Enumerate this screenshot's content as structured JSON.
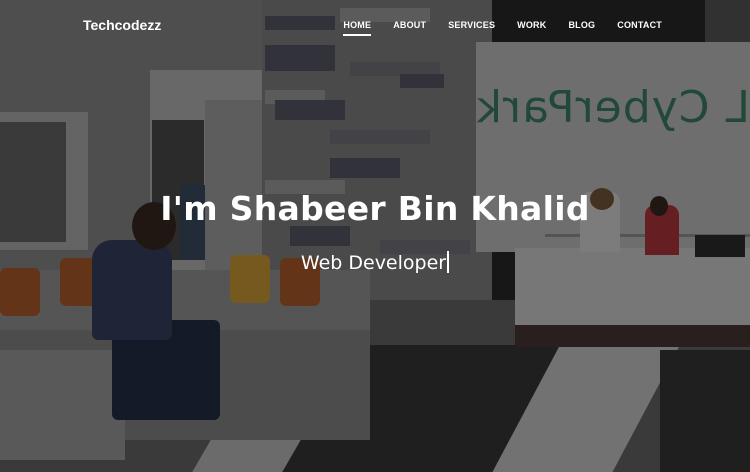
{
  "brand": "Techcodezz",
  "nav": {
    "items": [
      {
        "label": "HOME",
        "active": true
      },
      {
        "label": "ABOUT",
        "active": false
      },
      {
        "label": "SERVICES",
        "active": false
      },
      {
        "label": "WORK",
        "active": false
      },
      {
        "label": "BLOG",
        "active": false
      },
      {
        "label": "CONTACT",
        "active": false
      }
    ]
  },
  "hero": {
    "title": "I'm Shabeer Bin Khalid",
    "subtitle": "Web Developer"
  },
  "background": {
    "sign_text": "L CyberPark",
    "sign_color": "#2f7c60"
  }
}
